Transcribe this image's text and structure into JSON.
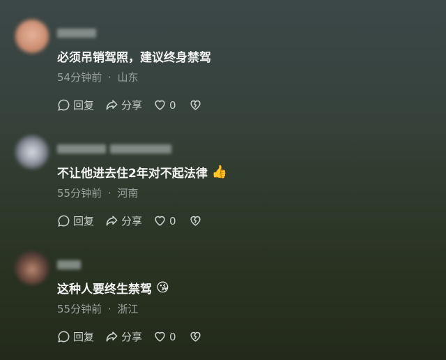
{
  "comments": [
    {
      "text": "必须吊销驾照，建议终身禁驾",
      "time": "54分钟前",
      "sep": "·",
      "location": "山东",
      "reply_label": "回复",
      "share_label": "分享",
      "like_count": "0",
      "emoji": ""
    },
    {
      "text": "不让他进去住2年对不起法律",
      "time": "55分钟前",
      "sep": "·",
      "location": "河南",
      "reply_label": "回复",
      "share_label": "分享",
      "like_count": "0",
      "emoji": "👍"
    },
    {
      "text": "这种人要终生禁驾",
      "time": "55分钟前",
      "sep": "·",
      "location": "浙江",
      "reply_label": "回复",
      "share_label": "分享",
      "like_count": "0",
      "emoji": "😘"
    }
  ],
  "icons": {
    "reply": "comment-bubble-icon",
    "share": "share-arrow-icon",
    "like": "heart-outline-icon",
    "dislike": "broken-heart-icon"
  },
  "colors": {
    "text": "#f4f4f4",
    "meta": "#9aa39e",
    "action": "#c9cfcb"
  }
}
